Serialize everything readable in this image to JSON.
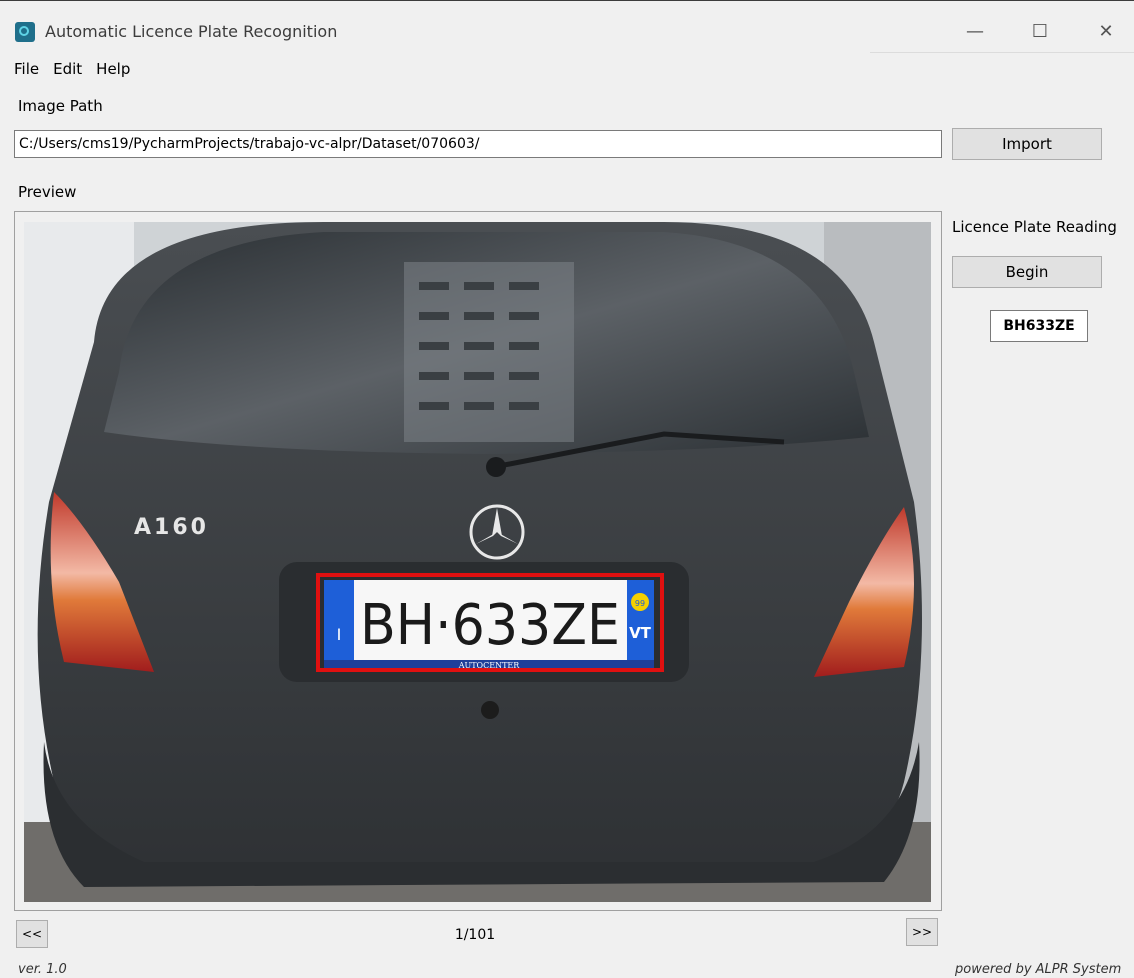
{
  "window": {
    "title": "Automatic Licence Plate Recognition",
    "controls": {
      "minimize": "—",
      "maximize": "☐",
      "close": "✕"
    }
  },
  "menu": {
    "items": [
      "File",
      "Edit",
      "Help"
    ]
  },
  "image_path": {
    "label": "Image Path",
    "value": "C:/Users/cms19/PycharmProjects/trabajo-vc-alpr/Dataset/070603/",
    "import_label": "Import"
  },
  "preview": {
    "label": "Preview"
  },
  "car": {
    "model_badge": "A160",
    "plate_text": "BH·633ZE",
    "plate_country": "I",
    "plate_region": "VT",
    "plate_region_year": "99",
    "plate_dealer": "AUTOCENTER"
  },
  "reading": {
    "label": "Licence Plate Reading",
    "begin_label": "Begin",
    "result": "BH633ZE"
  },
  "navigation": {
    "prev_label": "<<",
    "next_label": ">>",
    "counter": "1/101"
  },
  "footer": {
    "version": "ver. 1.0",
    "powered_by": "powered by ALPR System"
  },
  "colors": {
    "detection_box": "#e01010",
    "plate_blue": "#1e5fd8",
    "car_body": "#3a3d40"
  }
}
